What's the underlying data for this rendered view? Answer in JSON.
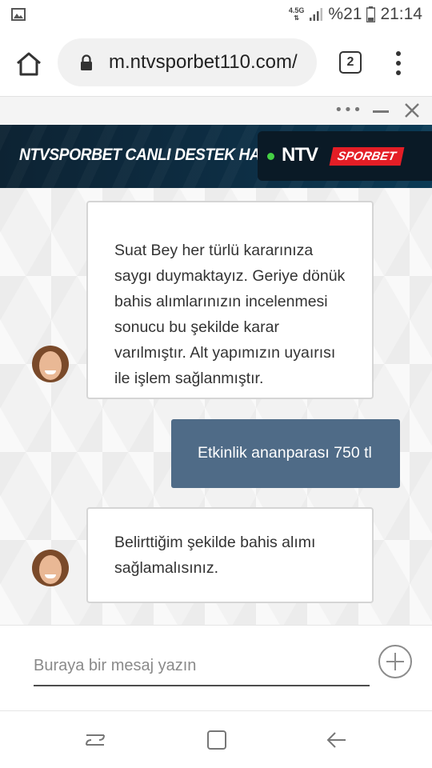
{
  "status_bar": {
    "network": "4.5G",
    "battery": "%21",
    "time": "21:14",
    "icons": [
      "image-icon",
      "signal-icon",
      "battery-icon"
    ]
  },
  "browser": {
    "url": "m.ntvsporbet110.com/",
    "tab_count": "2"
  },
  "chat_window": {
    "toolbar_dots": "•••"
  },
  "header": {
    "title": "NTVSPORBET CANLI DESTEK HATTI",
    "logo_ntv": "NTV",
    "logo_sporbet": "SPORBET",
    "status_color": "#44d044"
  },
  "messages": [
    {
      "sender": "agent",
      "lines": [
        "Suat Bey her türlü kararınıza",
        "saygı duymaktayız. Geriye dönük",
        "bahis alımlarınızın incelenmesi",
        "sonucu bu şekilde karar",
        "varılmıştır. Alt yapımızın uyaırısı",
        "ile işlem sağlanmıştır."
      ]
    },
    {
      "sender": "user",
      "text": "Etkinlik ananparası 750 tl"
    },
    {
      "sender": "agent",
      "lines": [
        "Belirttiğim şekilde bahis alımı",
        "sağlamalısınız."
      ]
    }
  ],
  "composer": {
    "placeholder": "Buraya bir mesaj yazın"
  },
  "colors": {
    "banner_bg": "#0d2333",
    "user_bubble": "#4f6b87",
    "sporbet_red": "#e41e26"
  }
}
